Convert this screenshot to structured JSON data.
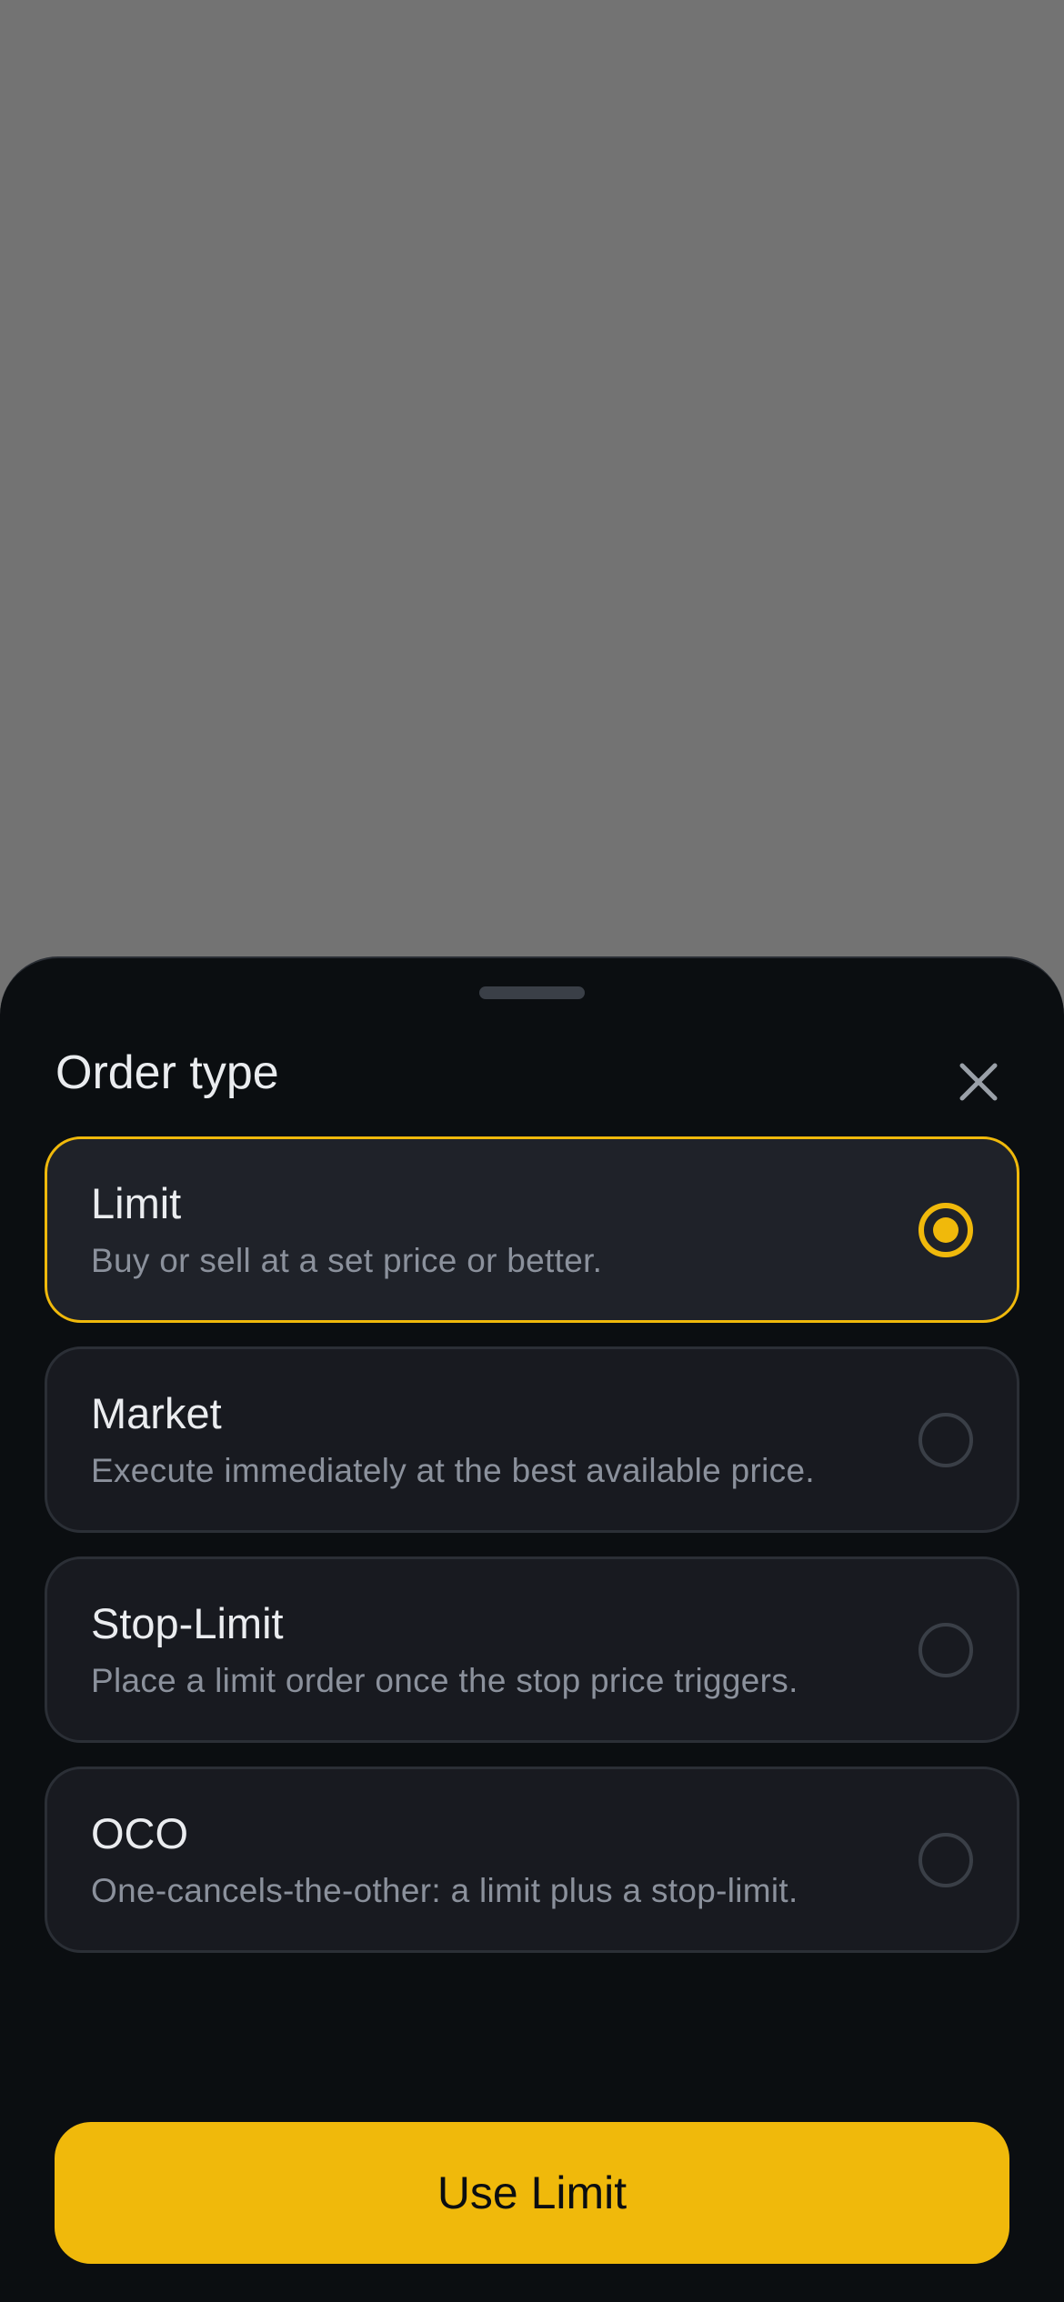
{
  "sheet": {
    "title": "Order type",
    "close_icon": "close-icon"
  },
  "options": [
    {
      "label": "Limit",
      "description": "Buy or sell at a set price or better.",
      "selected": true
    },
    {
      "label": "Market",
      "description": "Execute immediately at the best available price.",
      "selected": false
    },
    {
      "label": "Stop-Limit",
      "description": "Place a limit order once the stop price triggers.",
      "selected": false
    },
    {
      "label": "OCO",
      "description": "One-cancels-the-other: a limit plus a stop-limit.",
      "selected": false
    }
  ],
  "cta": {
    "label": "Use Limit"
  },
  "colors": {
    "accent": "#f0b90b",
    "sheet_bg": "#0b0e11",
    "card_bg": "#181a20",
    "backdrop": "#737373"
  }
}
